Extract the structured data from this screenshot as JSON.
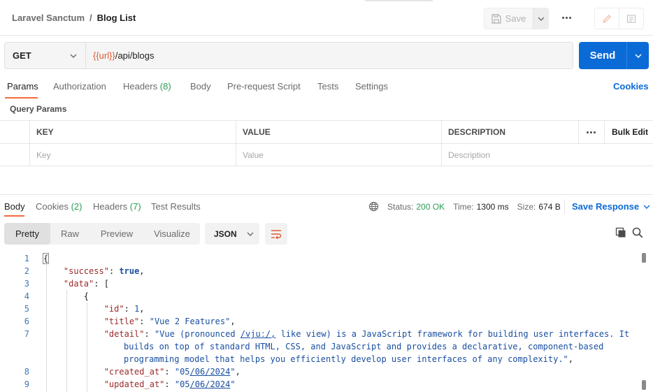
{
  "header": {
    "collection": "Laravel Sanctum",
    "separator": "/",
    "request_name": "Blog List",
    "save_label": "Save"
  },
  "request": {
    "method": "GET",
    "url_variable": "{{url}}",
    "url_path": "/api/blogs",
    "send_label": "Send"
  },
  "request_tabs": {
    "params": "Params",
    "authorization": "Authorization",
    "headers": "Headers",
    "headers_count": "(8)",
    "body": "Body",
    "prerequest": "Pre-request Script",
    "tests": "Tests",
    "settings": "Settings",
    "cookies": "Cookies"
  },
  "query_params": {
    "title": "Query Params",
    "columns": [
      "KEY",
      "VALUE",
      "DESCRIPTION"
    ],
    "bulk_edit": "Bulk Edit",
    "placeholders": [
      "Key",
      "Value",
      "Description"
    ]
  },
  "response_tabs": {
    "body": "Body",
    "cookies": "Cookies",
    "cookies_count": "(2)",
    "headers": "Headers",
    "headers_count": "(7)",
    "test_results": "Test Results"
  },
  "status": {
    "status_label": "Status:",
    "status_value": "200 OK",
    "time_label": "Time:",
    "time_value": "1300 ms",
    "size_label": "Size:",
    "size_value": "674 B",
    "save_response": "Save Response"
  },
  "view_modes": [
    "Pretty",
    "Raw",
    "Preview",
    "Visualize"
  ],
  "format": "JSON",
  "code_lines": {
    "l1": "{",
    "l2_key": "\"success\"",
    "l2_val": "true",
    "l3_key": "\"data\"",
    "l3_open": "[",
    "l4": "{",
    "l5_key": "\"id\"",
    "l5_val": "1",
    "l6_key": "\"title\"",
    "l6_val": "\"Vue 2 Features\"",
    "l7_key": "\"detail\"",
    "l7_a": "\"Vue (pronounced ",
    "l7_b": "/vjuː/,",
    "l7_c": " like view) is a JavaScript framework for building user interfaces. It",
    "l7_d": "builds on top of standard HTML, CSS, and JavaScript and provides a declarative, component-based",
    "l7_e": "programming model that helps you efficiently develop user interfaces of any complexity.\"",
    "l8_key": "\"created_at\"",
    "l8_a": "\"05",
    "l8_b": "/06/2024",
    "l8_c": "\"",
    "l9_key": "\"updated_at\"",
    "l9_a": "\"05",
    "l9_b": "/06/2024",
    "l9_c": "\""
  },
  "line_numbers": [
    "1",
    "2",
    "3",
    "4",
    "5",
    "6",
    "7",
    "8",
    "9"
  ]
}
